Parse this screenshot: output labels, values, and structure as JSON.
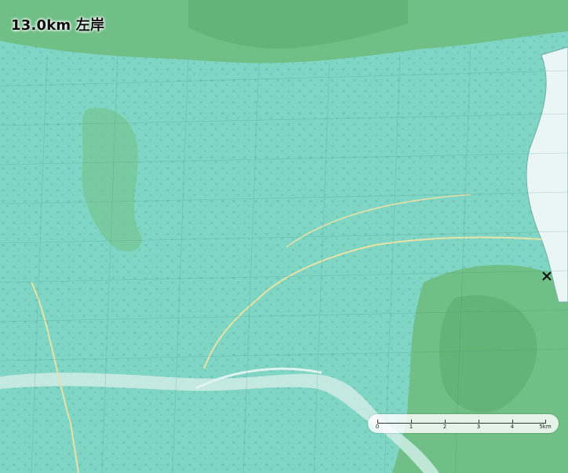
{
  "map": {
    "title": "13.0km 左岸",
    "marker_icon": "close-x-marker",
    "scale": {
      "ticks": [
        "0",
        "1",
        "2",
        "3",
        "4",
        "5km"
      ]
    },
    "colors": {
      "plain": "#7fd6c4",
      "hills": "#6fbf86",
      "river": "#e9f6f4",
      "road": "#e9e2a6",
      "blocks": "#5fb3a3"
    }
  }
}
